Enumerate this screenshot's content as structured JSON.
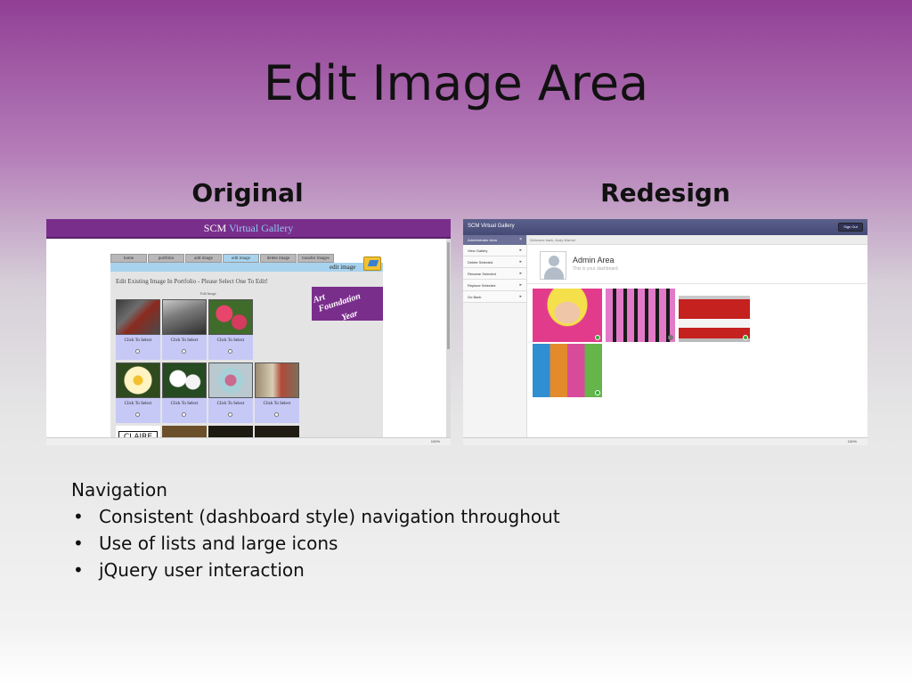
{
  "slide": {
    "title": "Edit Image Area",
    "original_heading": "Original",
    "redesign_heading": "Redesign"
  },
  "original": {
    "site_title_main": "SCM",
    "site_title_accent": "Virtual Gallery",
    "tabs": [
      "home",
      "portfolio",
      "add image",
      "edit image",
      "delete image",
      "transfer images"
    ],
    "active_tab": "edit image",
    "banner_label": "edit image",
    "heading": "Edit Existing Image In Portfolio - Please Select One To Edit!",
    "subheading": "Edit Image",
    "logo_lines": [
      "Art",
      "Foundation",
      "Year"
    ],
    "select_caption": "Click To Select",
    "partial_tile_text": "CLAIRE",
    "zoom": "100%"
  },
  "redesign": {
    "app_title": "SCM Virtual Gallery",
    "sign_out": "Sign Out",
    "sidebar_header": "Administrator Area",
    "sidebar_items": [
      "View Gallery",
      "Delete Selected",
      "Rename Selected",
      "Replace Selected",
      "Go Back"
    ],
    "welcome": "Welcome back, Andy Warhol",
    "area_title": "Admin Area",
    "area_subtitle": "This is your dashboard.",
    "zoom": "100%"
  },
  "notes": {
    "lead": "Navigation",
    "bullets": [
      "Consistent (dashboard style) navigation throughout",
      "Use of lists and large icons",
      "jQuery user interaction"
    ]
  },
  "colors": {
    "brand_purple": "#7a2e8c",
    "tab_blue": "#a7d3ee",
    "select_lavender": "#c6c9f6",
    "dashboard_nav": "#454a75",
    "selected_check": "#2fae39"
  }
}
